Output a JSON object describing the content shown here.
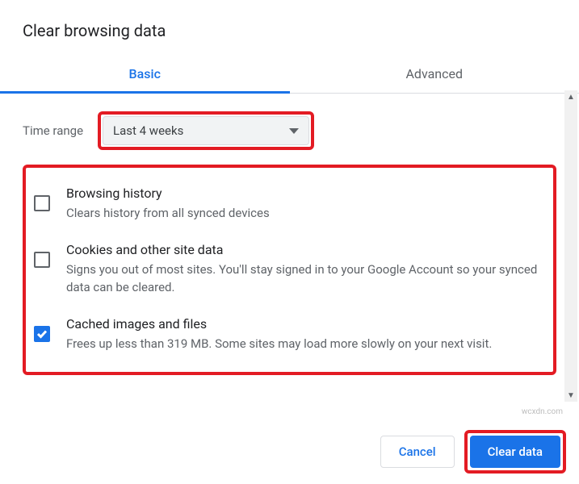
{
  "dialog": {
    "title": "Clear browsing data"
  },
  "tabs": {
    "basic": "Basic",
    "advanced": "Advanced",
    "active": "basic"
  },
  "time_range": {
    "label": "Time range",
    "selected": "Last 4 weeks"
  },
  "options": {
    "browsing_history": {
      "title": "Browsing history",
      "desc": "Clears history from all synced devices",
      "checked": false
    },
    "cookies": {
      "title": "Cookies and other site data",
      "desc": "Signs you out of most sites. You'll stay signed in to your Google Account so your synced data can be cleared.",
      "checked": false
    },
    "cache": {
      "title": "Cached images and files",
      "desc": "Frees up less than 319 MB. Some sites may load more slowly on your next visit.",
      "checked": true
    }
  },
  "footer": {
    "cancel": "Cancel",
    "clear": "Clear data"
  },
  "watermark": "wcxdn.com"
}
